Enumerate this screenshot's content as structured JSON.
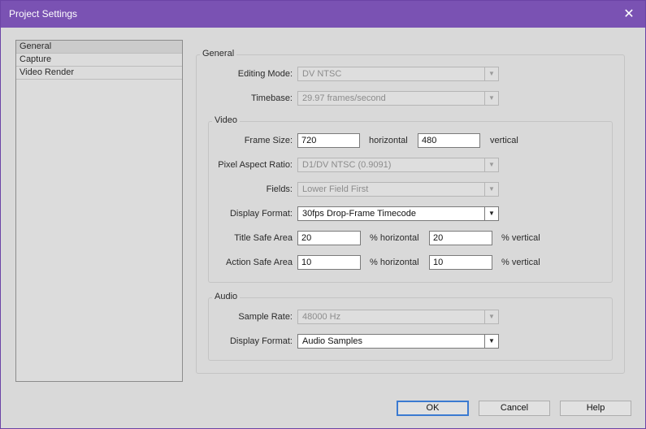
{
  "window": {
    "title": "Project Settings"
  },
  "sidebar": {
    "items": [
      {
        "label": "General"
      },
      {
        "label": "Capture"
      },
      {
        "label": "Video Render"
      }
    ]
  },
  "general": {
    "heading": "General",
    "editing_mode_label": "Editing Mode:",
    "editing_mode_value": "DV NTSC",
    "timebase_label": "Timebase:",
    "timebase_value": "29.97 frames/second"
  },
  "video": {
    "heading": "Video",
    "frame_size_label": "Frame Size:",
    "frame_width": "720",
    "horizontal_label": "horizontal",
    "frame_height": "480",
    "vertical_label": "vertical",
    "pixel_aspect_label": "Pixel Aspect Ratio:",
    "pixel_aspect_value": "D1/DV NTSC (0.9091)",
    "fields_label": "Fields:",
    "fields_value": "Lower Field First",
    "display_format_label": "Display Format:",
    "display_format_value": "30fps Drop-Frame Timecode",
    "title_safe_label": "Title Safe Area",
    "title_safe_h": "20",
    "pct_horizontal_label": "% horizontal",
    "title_safe_v": "20",
    "pct_vertical_label": "% vertical",
    "action_safe_label": "Action Safe Area",
    "action_safe_h": "10",
    "action_safe_v": "10"
  },
  "audio": {
    "heading": "Audio",
    "sample_rate_label": "Sample Rate:",
    "sample_rate_value": "48000 Hz",
    "display_format_label": "Display Format:",
    "display_format_value": "Audio Samples"
  },
  "buttons": {
    "ok": "OK",
    "cancel": "Cancel",
    "help": "Help"
  }
}
